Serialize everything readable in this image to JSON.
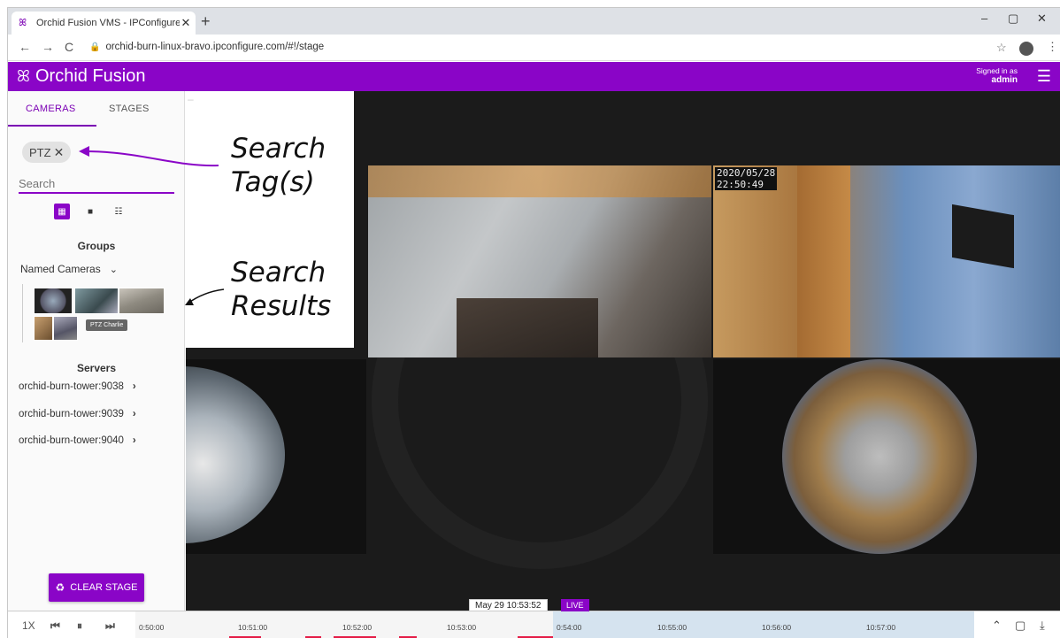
{
  "browser": {
    "tab_title": "Orchid Fusion VMS - IPConfigure",
    "tab_close": "✕",
    "new_tab": "+",
    "minimize": "–",
    "maximize": "▢",
    "close": "✕",
    "back": "←",
    "forward": "→",
    "reload": "C",
    "url": "orchid-burn-linux-bravo.ipconfigure.com/#!/stage"
  },
  "app": {
    "brand": "Orchid Fusion",
    "signed_in_label": "Signed in as",
    "signed_in_user": "admin",
    "accent_color": "#8a05c7"
  },
  "sidebar": {
    "tabs": [
      {
        "label": "CAMERAS",
        "active": true
      },
      {
        "label": "STAGES",
        "active": false
      }
    ],
    "tag_chip": "PTZ",
    "search_placeholder": "Search",
    "groups_heading": "Groups",
    "group_select": "Named Cameras",
    "thumbnail_tooltip": "PTZ Charlie",
    "servers_heading": "Servers",
    "servers": [
      "orchid-burn-tower:9038",
      "orchid-burn-tower:9039",
      "orchid-burn-tower:9040"
    ],
    "clear_stage": "CLEAR STAGE"
  },
  "annotations": {
    "search_tags_line1": "Search",
    "search_tags_line2": "Tag(s)",
    "search_results_line1": "Search",
    "search_results_line2": "Results"
  },
  "stage": {
    "tiles": [
      {
        "id": "room-corner",
        "timestamp": ""
      },
      {
        "id": "hallway",
        "timestamp": "2020/05/28\n22:50:49"
      },
      {
        "id": "fisheye-left",
        "timestamp": ""
      },
      {
        "id": "fisheye-right",
        "timestamp": ""
      }
    ]
  },
  "timeline": {
    "speed": "1X",
    "cursor_time": "May 29 10:53:52",
    "live_label": "LIVE",
    "ticks": [
      "0:50:00",
      "10:51:00",
      "10:52:00",
      "10:53:00",
      "0:54:00",
      "10:55:00",
      "10:56:00",
      "10:57:00"
    ]
  }
}
